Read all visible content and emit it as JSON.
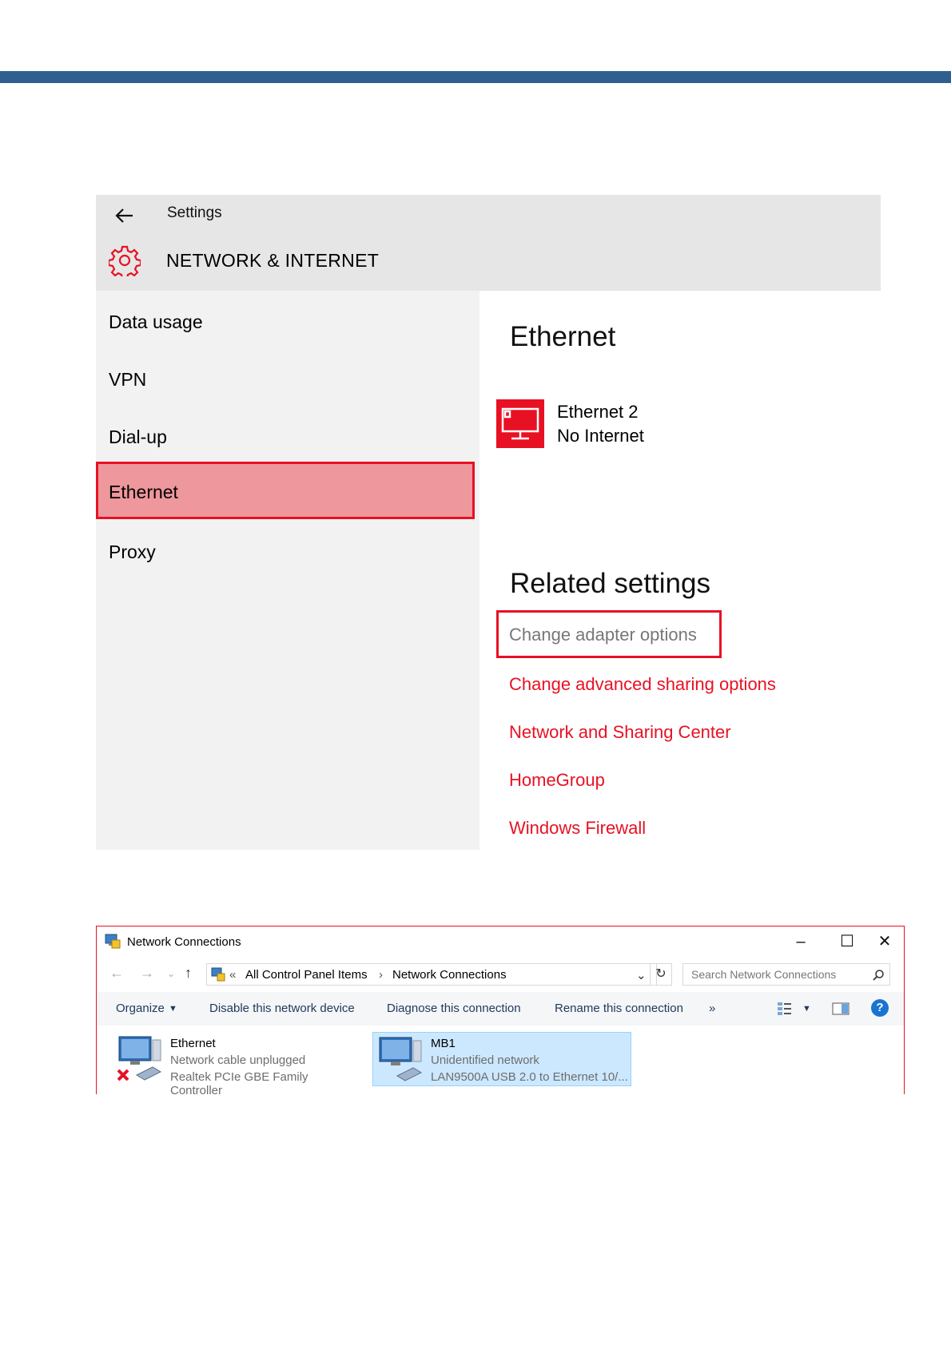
{
  "settings": {
    "window_title": "Settings",
    "section_title": "NETWORK & INTERNET",
    "nav": [
      "Data usage",
      "VPN",
      "Dial-up",
      "Ethernet",
      "Proxy"
    ],
    "main_heading": "Ethernet",
    "connection_name": "Ethernet 2",
    "connection_status": "No Internet",
    "related_heading": "Related settings",
    "links": [
      "Change adapter options",
      "Change advanced sharing options",
      "Network and Sharing Center",
      "HomeGroup",
      "Windows Firewall"
    ],
    "accent_color": "#e81123"
  },
  "network_connections": {
    "window_title": "Network Connections",
    "breadcrumb": [
      "All Control Panel Items",
      "Network Connections"
    ],
    "search_placeholder": "Search Network Connections",
    "toolbar": [
      "Organize",
      "Disable this network device",
      "Diagnose this connection",
      "Rename this connection",
      "»"
    ],
    "items": [
      {
        "name": "Ethernet",
        "status": "Network cable unplugged",
        "device": "Realtek PCIe GBE Family Controller"
      },
      {
        "name": "MB1",
        "status": "Unidentified network",
        "device": "LAN9500A USB 2.0 to Ethernet 10/..."
      }
    ]
  }
}
